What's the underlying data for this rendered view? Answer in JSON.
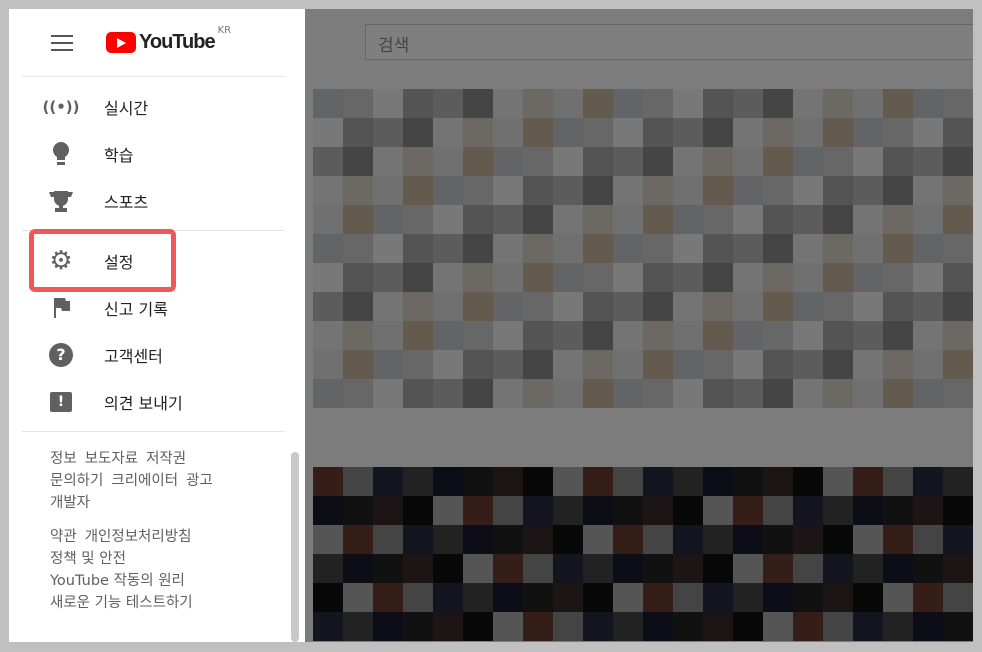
{
  "header": {
    "logo_text": "YouTube",
    "region": "KR",
    "search_placeholder": "검색"
  },
  "sidebar": {
    "explore": [
      {
        "label": "실시간",
        "icon": "live-icon"
      },
      {
        "label": "학습",
        "icon": "lightbulb-icon"
      },
      {
        "label": "스포츠",
        "icon": "trophy-icon"
      }
    ],
    "more": [
      {
        "label": "설정",
        "icon": "gear-icon",
        "highlighted": true
      },
      {
        "label": "신고 기록",
        "icon": "flag-icon"
      },
      {
        "label": "고객센터",
        "icon": "help-icon"
      },
      {
        "label": "의견 보내기",
        "icon": "feedback-icon"
      }
    ],
    "footer1": [
      "정보",
      "보도자료",
      "저작권",
      "문의하기",
      "크리에이터",
      "광고",
      "개발자"
    ],
    "footer2": [
      "약관",
      "개인정보처리방침",
      "정책 및 안전",
      "YouTube 작동의 원리",
      "새로운 기능 테스트하기"
    ]
  },
  "colors": {
    "highlight": "#f0575a",
    "brand": "#ff0000"
  }
}
